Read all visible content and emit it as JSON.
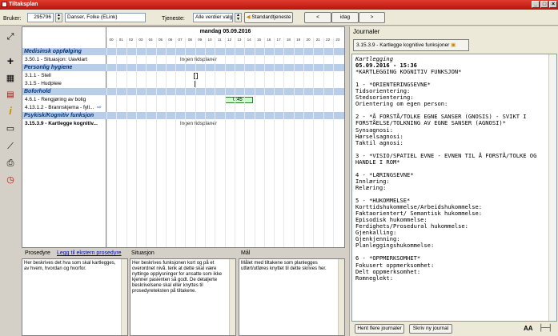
{
  "window": {
    "title": "Tiltaksplan",
    "min": "_",
    "max": "□",
    "close": "×"
  },
  "toolbar": {
    "bruker_label": "Bruker:",
    "bruker_id": "295796",
    "bruker_name": "Danser, Folke (ELink)",
    "tjeneste_label": "Tjeneste:",
    "tjeneste_value": "Alle verdier valgt",
    "standard_button": "Standardtjeneste",
    "prev": "<",
    "today": "idag",
    "next": ">"
  },
  "grid": {
    "date": "mandag 05.09.2016",
    "hours": [
      "00",
      "01",
      "02",
      "03",
      "04",
      "05",
      "06",
      "07",
      "08",
      "09",
      "10",
      "11",
      "12",
      "13",
      "14",
      "15",
      "16",
      "17",
      "18",
      "19",
      "20",
      "21",
      "22",
      "23"
    ],
    "categories": [
      "Medisinsk oppfølging",
      "Personlig hygiene",
      "Boforhold",
      "Psykisk/Kognitiv funksjon"
    ],
    "rows": [
      "3.50.1 - Situasjon: Uavklart",
      "3.1.1 - Stell",
      "3.1.5 - Hudpleie",
      "4.6.1 - Rengjøring av bolig",
      "4.13.1.2 - Brannskjema - fyll...",
      "3.15.3.9 - Kartlegge kognitiv..."
    ],
    "no_plan": "Ingen tidsplaner",
    "time_label": "0:45"
  },
  "bottom": {
    "prosedyre_label": "Prosedyre",
    "ekstern_link": "Legg til ekstern prosedyre",
    "prosedyre_text": "Her beskrives det hva som skal kartlegges, av hvem, hvordan og hvorfor.",
    "situasjon_label": "Situasjon",
    "situasjon_text": "Her beskrives funksjonen kort og på et overordnet nivå. tenk at dette skal være nyttinge opplysninger for ansatte som ikke kjenner pasienten så godt. De detaljerte beskrivelsene skal eller knyttes til prosedyreteksten på tiltakene.",
    "maal_label": "Mål",
    "maal_text": "Målet med tiltakene som planlegges utført/utføres knyttet til dette skrives her."
  },
  "journal": {
    "title": "Journaler",
    "selected": "3.15.3.9 - Kartlegge kognitive funksjoner",
    "lines": [
      "Kartlegging",
      "05.09.2016 - 15:36",
      "*KARTLEGGING KOGNITIV FUNKSJON*",
      "",
      "1 - *ORIENTERINGSEVNE*",
      "Tidsorientering:",
      "Stedsorientering:",
      "Orientering om egen person:",
      "",
      "2 - *Å FORSTÅ/TOLKE EGNE SANSER (GNOSIS) - SVIKT I",
      "FORSTÅELSE/TOLKNING AV EGNE SANSER (AGNOSI)*",
      "Synsagnosi:",
      "Hørselsagnosi:",
      "Taktil agnosi:",
      "",
      "3 - *VISIO/SPATIEL EVNE - EVNEN TIL Å FORSTÅ/TOLKE OG",
      "HANDLE I ROM*",
      "",
      "4 - *LÆRINGSEVNE*",
      "Innlæring:",
      "Relæring:",
      "",
      "5 - *HUKOMMELSE*",
      "Korttidshukommelse/Arbeidshukommelse:",
      "Faktaorientert/ Semantisk hukommelse:",
      "Episodisk hukommelse:",
      "Ferdighets/Prosedural hukommelse:",
      "Gjenkalling:",
      "Gjenkjenning:",
      "Planleggingshukommelse:",
      "",
      "6 - *OPPMERKSOMHET*",
      "Fokusert oppmerksomhet:",
      "Delt oppmerksomhet:",
      "Romneglekt:"
    ],
    "hent_button": "Hent flere journaler",
    "skriv_button": "Skriv ny journal",
    "font_label": "AA"
  }
}
